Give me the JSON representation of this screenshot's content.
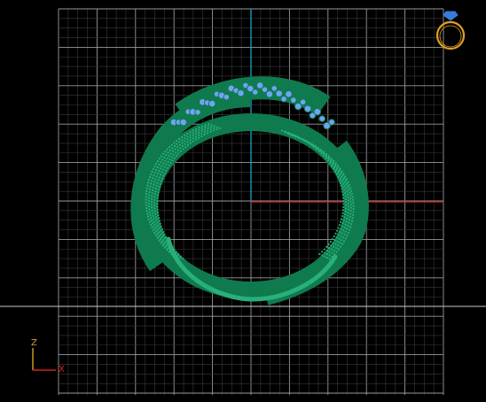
{
  "viewport": {
    "background": "#000000",
    "grid_minor_color": "#3a3a3a",
    "grid_major_color": "#9a9a9a",
    "horizon_color": "#c8c8c8",
    "vertical_axis_color": "#1aa3c4",
    "horizontal_axis_color": "#c21b1b"
  },
  "model": {
    "kind": "twisted ring with pave set gemstones",
    "metal_color": "#0f7a4e",
    "metal_highlight": "#27b07a",
    "stone_color": "#6fa3f5"
  },
  "orientation_gizmo": {
    "icon": "ring-view-icon",
    "color": "#e0a020",
    "gem_color": "#3a7ad8"
  },
  "axis_triad": {
    "vertical_label": "Z",
    "horizontal_label": "X",
    "z_color": "#d9a42a",
    "x_color": "#d62020"
  }
}
